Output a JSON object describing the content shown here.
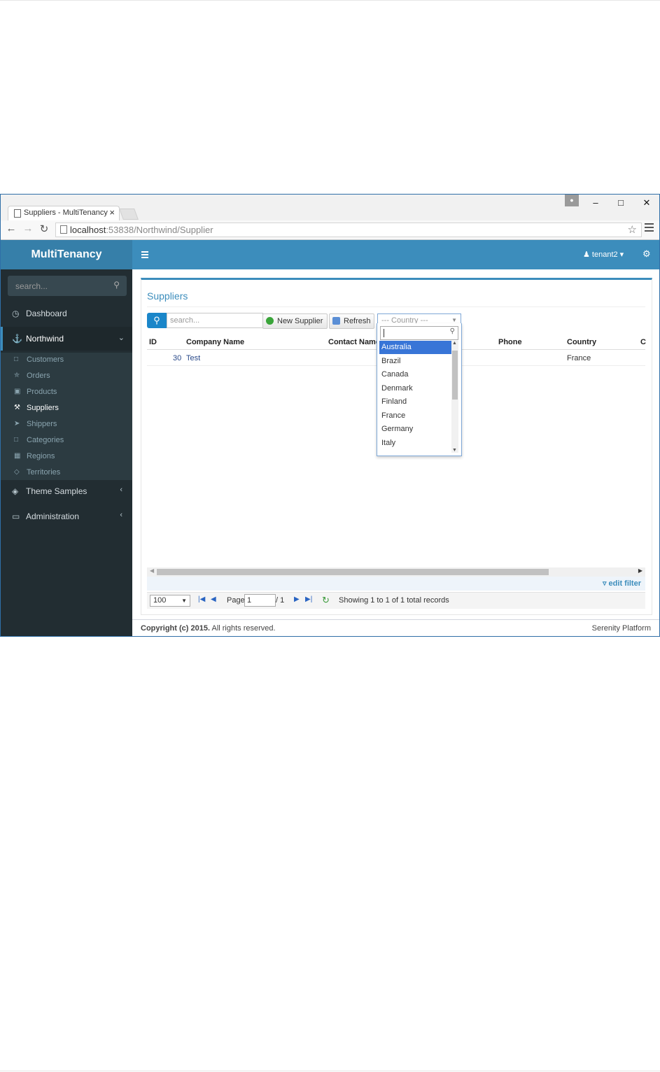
{
  "browser": {
    "tab_title": "Suppliers - MultiTenancy",
    "url_host": "localhost",
    "url_rest": ":53838/Northwind/Supplier"
  },
  "app": {
    "brand": "MultiTenancy",
    "user": "tenant2"
  },
  "sidebar": {
    "search_placeholder": "search...",
    "items": [
      {
        "label": "Dashboard"
      },
      {
        "label": "Northwind"
      },
      {
        "label": "Theme Samples"
      },
      {
        "label": "Administration"
      }
    ],
    "northwind_items": [
      {
        "label": "Customers"
      },
      {
        "label": "Orders"
      },
      {
        "label": "Products"
      },
      {
        "label": "Suppliers"
      },
      {
        "label": "Shippers"
      },
      {
        "label": "Categories"
      },
      {
        "label": "Regions"
      },
      {
        "label": "Territories"
      }
    ]
  },
  "page": {
    "title": "Suppliers",
    "search_placeholder": "search...",
    "new_button": "New Supplier",
    "refresh_button": "Refresh",
    "country_placeholder": "--- Country ---"
  },
  "grid": {
    "columns": [
      "ID",
      "Company Name",
      "Contact Name",
      "Phone",
      "Country",
      "C"
    ],
    "rows": [
      {
        "id": "30",
        "company": "Test",
        "country": "France"
      }
    ]
  },
  "country_dropdown": {
    "options": [
      "Australia",
      "Brazil",
      "Canada",
      "Denmark",
      "Finland",
      "France",
      "Germany",
      "Italy"
    ],
    "highlighted": "Australia"
  },
  "pager": {
    "page_size": "100",
    "page_label": "Page",
    "page_value": "1",
    "page_total": "/ 1",
    "status": "Showing 1 to 1 of 1 total records",
    "edit_filter": "edit filter"
  },
  "footer": {
    "copyright_bold": "Copyright (c) 2015.",
    "copyright_rest": " All rights reserved.",
    "platform": "Serenity Platform"
  },
  "colors": {
    "header": "#3c8dbc",
    "sidebar": "#222d32",
    "highlight": "#3875d7"
  }
}
